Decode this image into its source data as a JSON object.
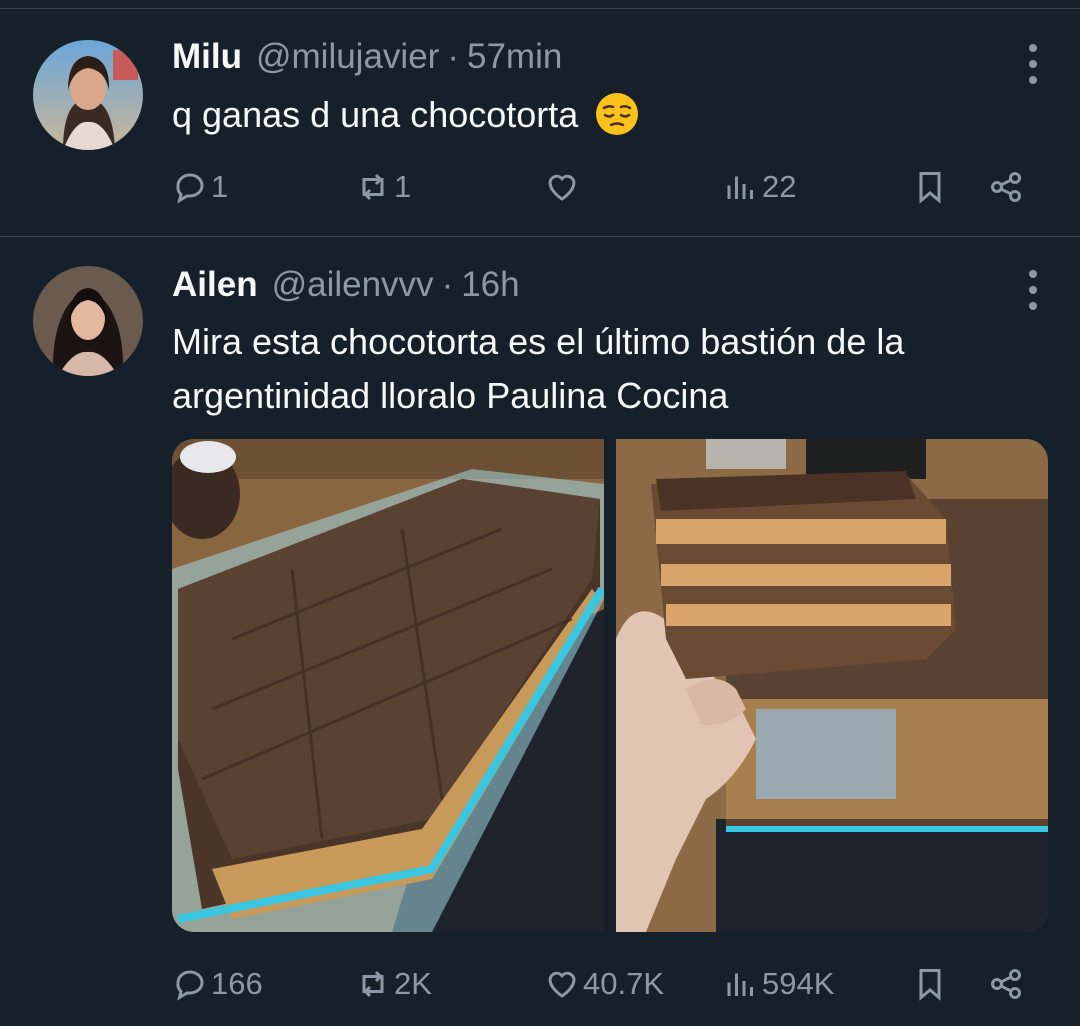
{
  "tweets": [
    {
      "name": "Milu",
      "handle": "@milujavier",
      "separator": "·",
      "time": "57min",
      "text": "q ganas d una chocotorta",
      "emoji": "pensive-face",
      "replies": "1",
      "retweets": "1",
      "likes": "",
      "views": "22"
    },
    {
      "name": "Ailen",
      "handle": "@ailenvvv",
      "separator": "·",
      "time": "16h",
      "text": "Mira esta chocotorta es el último bastión de la argentinidad lloralo Paulina Cocina",
      "replies": "166",
      "retweets": "2K",
      "likes": "40.7K",
      "views": "594K",
      "images": [
        "chocotorta-tray-photo",
        "chocotorta-slice-photo"
      ]
    }
  ],
  "icons": [
    "reply-icon",
    "retweet-icon",
    "like-icon",
    "views-icon",
    "bookmark-icon",
    "share-icon",
    "more-icon"
  ],
  "colors": {
    "background": "#15202b",
    "text": "#f7f9f9",
    "muted": "#8b98a5",
    "divider": "#38444d"
  }
}
